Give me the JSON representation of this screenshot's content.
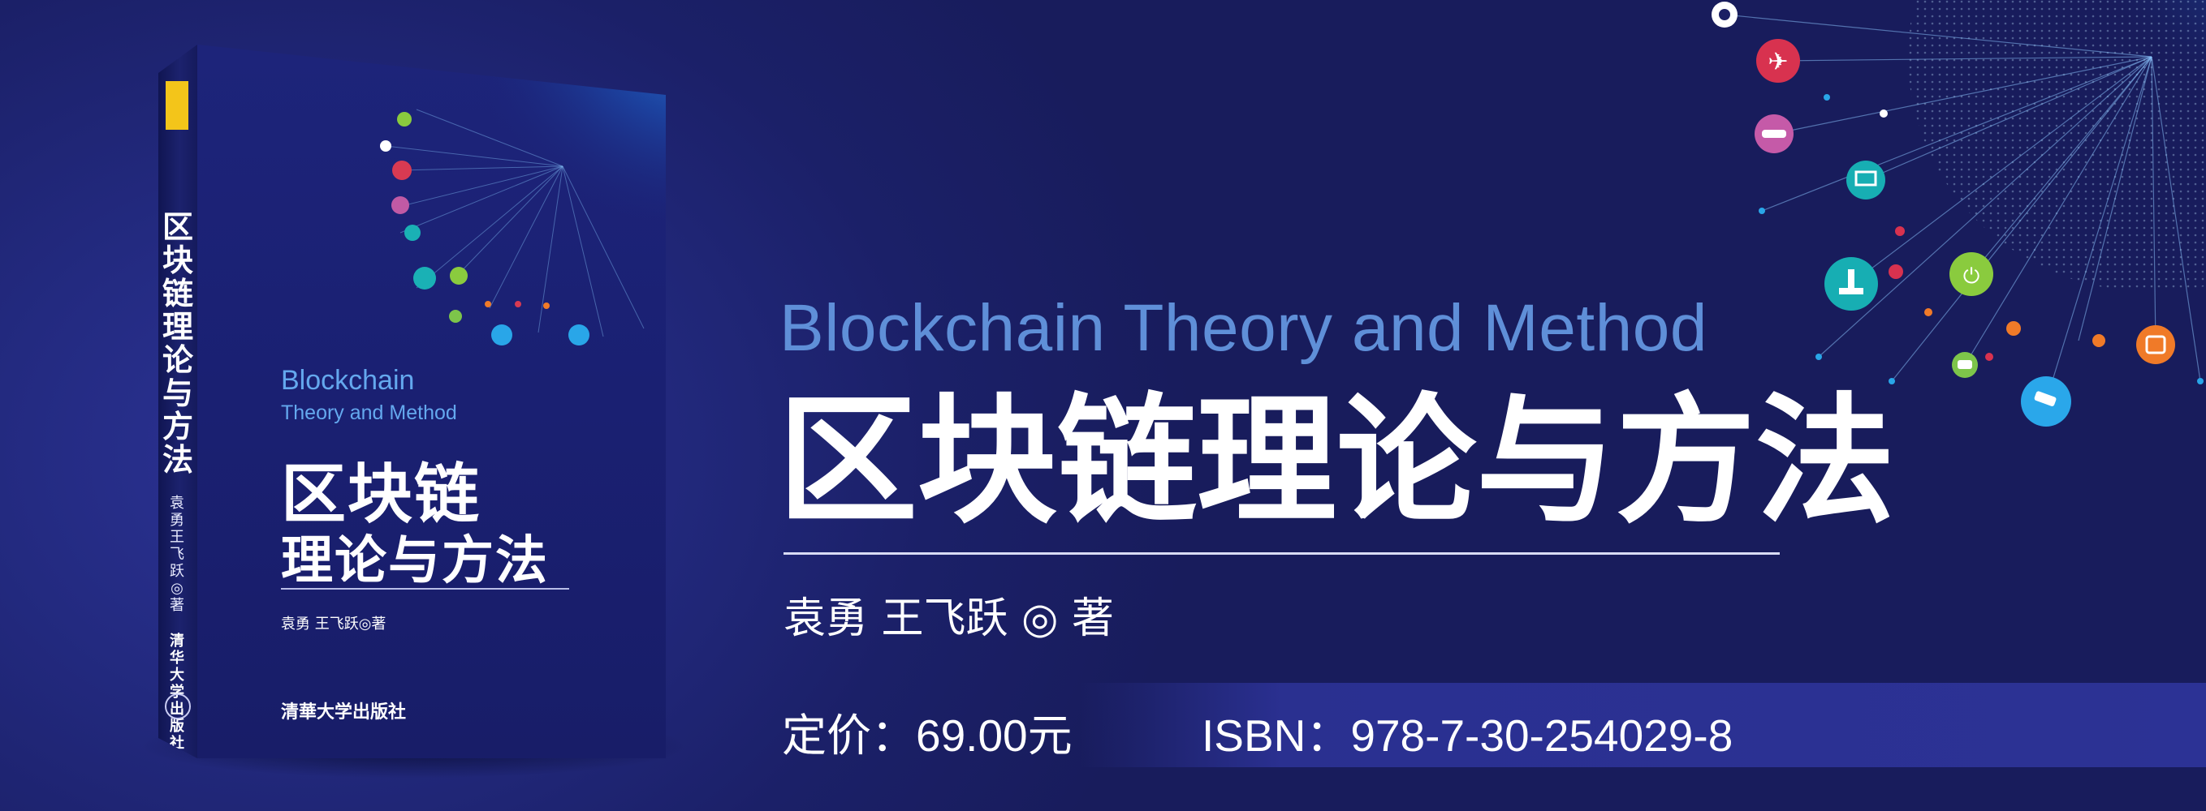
{
  "book": {
    "spine_title": "区块链理论与方法",
    "spine_authors": "袁勇 王飞跃◎著",
    "spine_publisher": "清华大学出版社",
    "cover_title_en_line1": "Blockchain",
    "cover_title_en_line2": "Theory and Method",
    "cover_title_cn_line1": "区块链",
    "cover_title_cn_line2": "理论与方法",
    "cover_authors": "袁勇 王飞跃◎著",
    "cover_publisher": "清華大学出版社"
  },
  "banner": {
    "title_en": "Blockchain  Theory and Method",
    "title_cn": "区块链理论与方法",
    "authors": "袁勇  王飞跃 ◎ 著",
    "price": "定价：69.00元",
    "isbn": "ISBN：978-7-30-254029-8"
  },
  "colors": {
    "background": "#1b1f64",
    "accent_blue": "#5f8fd8",
    "price_band": "#2c3295"
  },
  "icons": [
    "gear-icon",
    "airplane-icon",
    "car-icon",
    "laptop-icon",
    "robot-arm-icon",
    "plug-icon",
    "chat-icon",
    "security-camera-icon",
    "wallet-icon"
  ]
}
